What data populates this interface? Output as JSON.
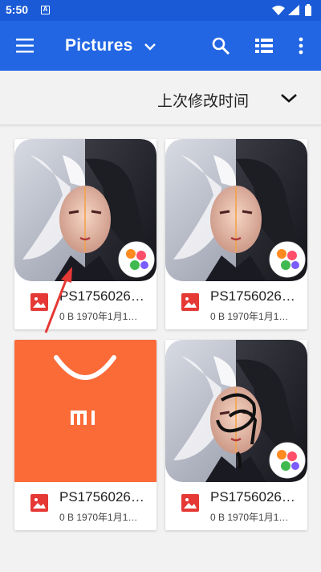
{
  "status_bar": {
    "time": "5:50",
    "notification_badge": "A",
    "icons": [
      "wifi-icon",
      "signal-icon",
      "battery-icon"
    ]
  },
  "app_bar": {
    "title": "Pictures",
    "icons": [
      "menu-icon",
      "chevron-down-icon",
      "search-icon",
      "grid-view-icon",
      "more-vert-icon"
    ],
    "color": "#2266e3"
  },
  "sort_bar": {
    "label": "上次修改时间"
  },
  "files": [
    {
      "name": "PS1756026…",
      "meta": "0 B 1970年1月1…",
      "thumbnail": "illustration-character"
    },
    {
      "name": "PS1756026…",
      "meta": "0 B 1970年1月1…",
      "thumbnail": "illustration-character"
    },
    {
      "name": "PS1756026…",
      "meta": "0 B 1970年1月1…",
      "thumbnail": "mi-logo"
    },
    {
      "name": "PS1756026…",
      "meta": "0 B 1970年1月1…",
      "thumbnail": "illustration-character-scribbled"
    }
  ],
  "colors": {
    "status_bar": "#1a5ad6",
    "file_icon": "#e53935",
    "mi_orange": "#fa6b38"
  }
}
